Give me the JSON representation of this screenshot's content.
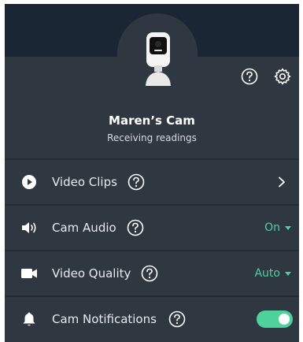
{
  "device": {
    "name": "Maren’s Cam",
    "status": "Receiving readings"
  },
  "header": {
    "help_icon": "help-circle-icon",
    "settings_icon": "gear-icon",
    "camera_icon": "camera-device-icon"
  },
  "settings": {
    "video_clips": {
      "label": "Video Clips",
      "icon": "play-circle-icon"
    },
    "cam_audio": {
      "label": "Cam Audio",
      "value": "On",
      "icon": "speaker-icon"
    },
    "video_quality": {
      "label": "Video Quality",
      "value": "Auto",
      "icon": "video-camera-icon"
    },
    "cam_notifications": {
      "label": "Cam Notifications",
      "enabled": true,
      "icon": "bell-icon"
    }
  },
  "colors": {
    "accent": "#4fd19b",
    "panel": "#2f3741",
    "header": "#1a2634"
  }
}
